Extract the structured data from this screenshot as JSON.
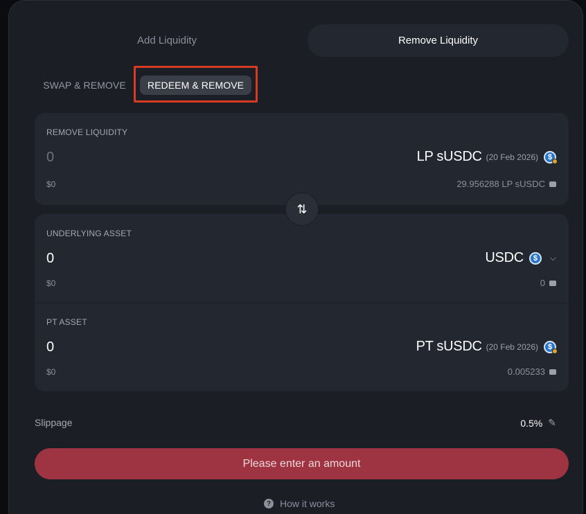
{
  "tabs": {
    "add": "Add Liquidity",
    "remove": "Remove Liquidity"
  },
  "subtabs": {
    "swap_remove": "SWAP & REMOVE",
    "redeem_remove": "REDEEM & REMOVE"
  },
  "remove_card": {
    "label": "REMOVE LIQUIDITY",
    "amount": "0",
    "usd": "$0",
    "asset": "LP sUSDC",
    "date": "(20 Feb 2026)",
    "balance": "29.956288 LP sUSDC"
  },
  "underlying_card": {
    "label": "UNDERLYING ASSET",
    "amount": "0",
    "usd": "$0",
    "asset": "USDC",
    "balance": "0"
  },
  "pt_card": {
    "label": "PT ASSET",
    "amount": "0",
    "usd": "$0",
    "asset": "PT sUSDC",
    "date": "(20 Feb 2026)",
    "balance": "0.005233"
  },
  "slippage": {
    "label": "Slippage",
    "value": "0.5%"
  },
  "cta": {
    "label": "Please enter an amount"
  },
  "footer": {
    "how_it_works": "How it works"
  },
  "icons": {
    "swap": "swap-arrows-icon",
    "wallet": "wallet-icon",
    "edit": "pencil-icon",
    "help": "question-icon",
    "chevron": "chevron-down-icon"
  },
  "colors": {
    "accent_highlight": "#d83a22",
    "cta_bg": "#9e3341",
    "usdc_blue": "#2775ca"
  }
}
